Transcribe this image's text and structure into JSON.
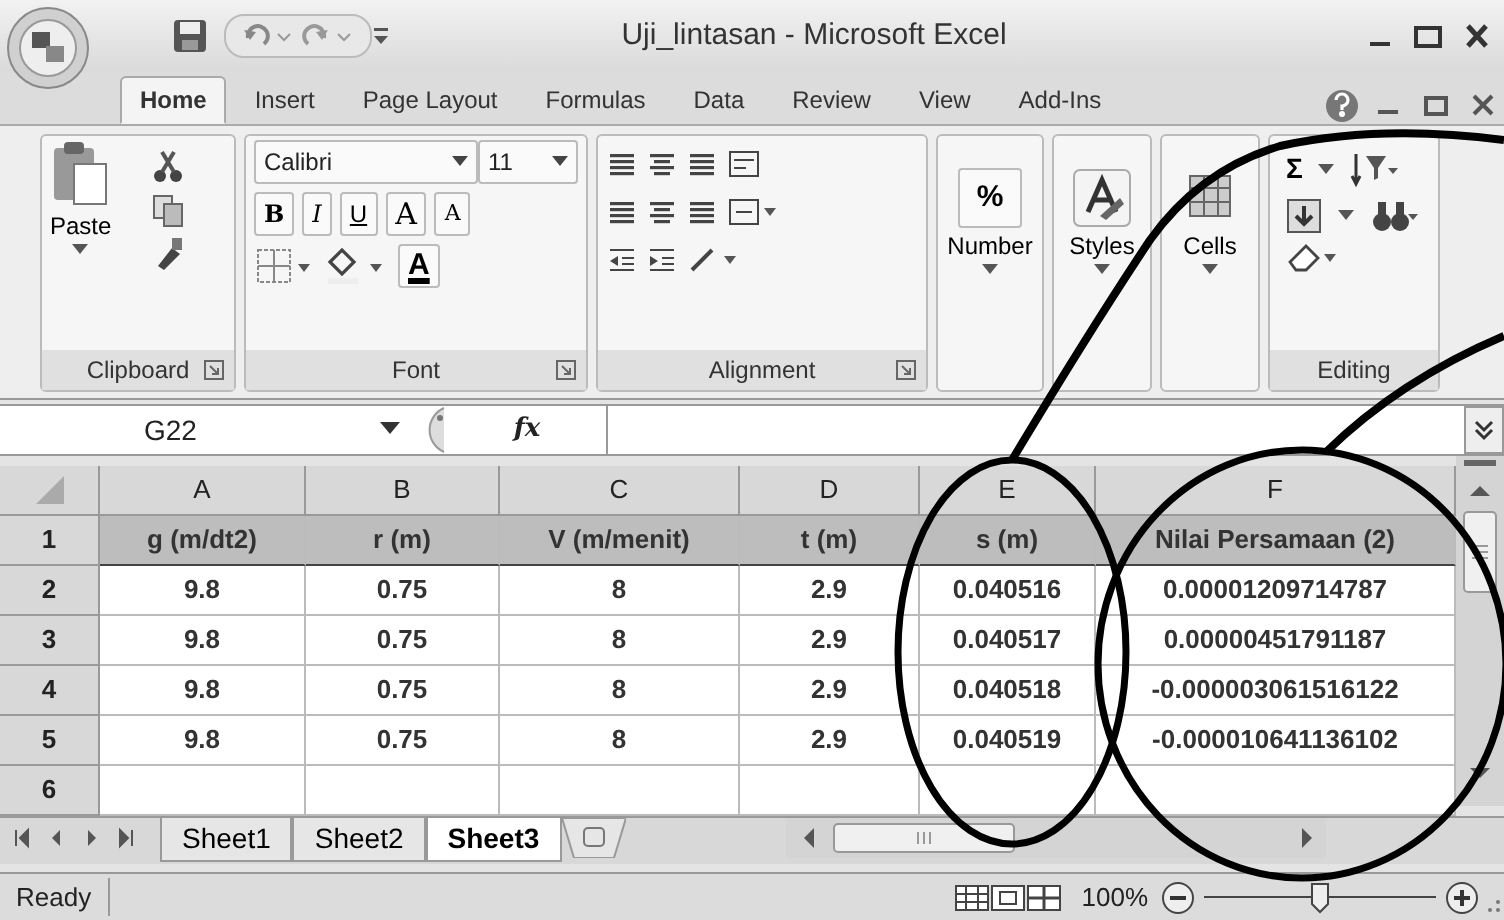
{
  "window": {
    "title": "Uji_lintasan - Microsoft Excel"
  },
  "ribbon_tabs": [
    {
      "label": "Home",
      "selected": true
    },
    {
      "label": "Insert",
      "selected": false
    },
    {
      "label": "Page Layout",
      "selected": false
    },
    {
      "label": "Formulas",
      "selected": false
    },
    {
      "label": "Data",
      "selected": false
    },
    {
      "label": "Review",
      "selected": false
    },
    {
      "label": "View",
      "selected": false
    },
    {
      "label": "Add-Ins",
      "selected": false
    }
  ],
  "ribbon_groups": [
    {
      "kind": "clipboard",
      "label": "Clipboard",
      "button": "Paste"
    },
    {
      "kind": "font",
      "label": "Font",
      "font_name": "Calibri",
      "font_size": "11",
      "buttons": [
        {
          "kind": "bold",
          "label": "B"
        },
        {
          "kind": "italic",
          "label": "I"
        },
        {
          "kind": "underline",
          "label": "U"
        },
        {
          "kind": "grow",
          "label": "A"
        },
        {
          "kind": "shrink",
          "label": "A"
        },
        {
          "kind": "color",
          "label": "A"
        }
      ]
    },
    {
      "kind": "alignment",
      "label": "Alignment"
    },
    {
      "kind": "number",
      "button": "Number",
      "symbol": "%"
    },
    {
      "kind": "styles",
      "button": "Styles"
    },
    {
      "kind": "cells",
      "button": "Cells"
    },
    {
      "kind": "editing",
      "label": "Editing",
      "symbol": "Σ"
    }
  ],
  "formula_bar": {
    "name_box": "G22",
    "fx": "fx"
  },
  "sheet": {
    "columns": [
      "A",
      "B",
      "C",
      "D",
      "E",
      "F"
    ],
    "rows": [
      {
        "number": "1",
        "cells": [
          "g (m/dt2)",
          "r (m)",
          "V (m/menit)",
          "t (m)",
          "s (m)",
          "Nilai Persamaan (2)"
        ]
      },
      {
        "number": "2",
        "cells": [
          "9.8",
          "0.75",
          "8",
          "2.9",
          "0.040516",
          "0.00001209714787"
        ]
      },
      {
        "number": "3",
        "cells": [
          "9.8",
          "0.75",
          "8",
          "2.9",
          "0.040517",
          "0.00000451791187"
        ]
      },
      {
        "number": "4",
        "cells": [
          "9.8",
          "0.75",
          "8",
          "2.9",
          "0.040518",
          "-0.000003061516122"
        ]
      },
      {
        "number": "5",
        "cells": [
          "9.8",
          "0.75",
          "8",
          "2.9",
          "0.040519",
          "-0.000010641136102"
        ]
      },
      {
        "number": "6"
      }
    ]
  },
  "sheet_tabs": [
    {
      "label": "Sheet1",
      "selected": false
    },
    {
      "label": "Sheet2",
      "selected": false
    },
    {
      "label": "Sheet3",
      "selected": true
    }
  ],
  "status_bar": {
    "status": "Ready",
    "zoom": "100%",
    "zoom_slider": {
      "level": 0.5
    }
  }
}
